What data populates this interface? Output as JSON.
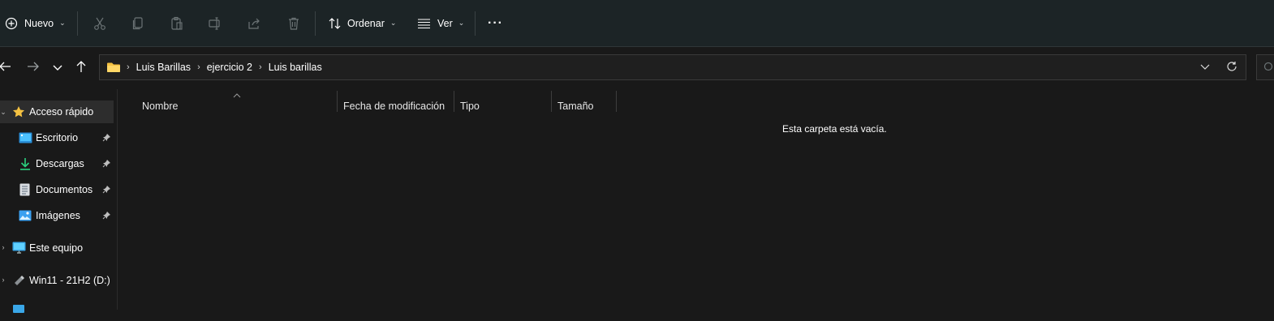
{
  "toolbar": {
    "new_label": "Nuevo",
    "sort_label": "Ordenar",
    "view_label": "Ver",
    "more_label": "···"
  },
  "address": {
    "crumbs": [
      "Luis Barillas",
      "ejercicio 2",
      "Luis barillas"
    ]
  },
  "sidebar": {
    "items": [
      {
        "label": "Acceso rápido",
        "icon": "star-icon"
      },
      {
        "label": "Escritorio",
        "icon": "desktop-folder-icon"
      },
      {
        "label": "Descargas",
        "icon": "download-icon"
      },
      {
        "label": "Documentos",
        "icon": "document-icon"
      },
      {
        "label": "Imágenes",
        "icon": "pictures-icon"
      },
      {
        "label": "Este equipo",
        "icon": "monitor-icon"
      },
      {
        "label": "Win11 - 21H2 (D:)",
        "icon": "usb-drive-icon"
      }
    ]
  },
  "columns": {
    "name": "Nombre",
    "modified": "Fecha de modificación",
    "type": "Tipo",
    "size": "Tamaño"
  },
  "empty_message": "Esta carpeta está vacía.",
  "colors": {
    "toolbar_bg": "#1c2426",
    "window_bg": "#191919",
    "selected_bg": "#2d2d2d",
    "folder_yellow": "#f5c242",
    "accent_blue": "#4cc2ff"
  }
}
